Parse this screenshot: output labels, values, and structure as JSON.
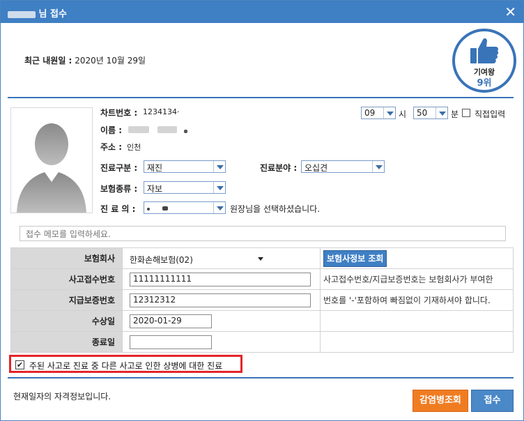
{
  "window": {
    "title_suffix": "님 접수",
    "close_symbol": "✕"
  },
  "header": {
    "recent_label": "최근 내원일 :",
    "recent_date": "2020년 10월 29일"
  },
  "badge": {
    "line1": "기여왕",
    "line2": "9위"
  },
  "patient": {
    "chart_label": "차트번호 :",
    "chart_no": "1234134·",
    "name_label": "이름 :",
    "address_label": "주소 :",
    "address": "인천",
    "visit_type_label": "진료구분 :",
    "visit_type": "재진",
    "field_label": "진료분야 :",
    "field": "오십견",
    "insurance_type_label": "보험종류 :",
    "insurance_type": "자보",
    "doctor_label": "진 료 의 :",
    "doctor_note": "원장님을 선택하셨습니다."
  },
  "time": {
    "hour": "09",
    "hour_unit": "시",
    "minute": "50",
    "minute_unit": "분",
    "manual_label": "직접입력"
  },
  "memo": {
    "placeholder": "접수 메모를 입력하세요."
  },
  "insurance": {
    "company_label": "보험회사",
    "company": "한화손해보험(02)",
    "lookup_button": "보험사정보 조회",
    "accident_no_label": "사고접수번호",
    "accident_no": "11111111111",
    "guarantee_no_label": "지급보증번호",
    "guarantee_no": "12312312",
    "injury_date_label": "수상일",
    "injury_date": "2020-01-29",
    "end_date_label": "종료일",
    "end_date": "",
    "note1": "사고접수번호/지급보증번호는 보험회사가 부여한",
    "note2": "번호를 '-'포함하여 빠짐없이 기재하셔야 합니다."
  },
  "checkbox": {
    "label": "주된 사고로 진료 중 다른 사고로 인한 상병에 대한 진료",
    "checked_mark": "✔"
  },
  "footer": {
    "note": "현재일자의 자격정보입니다.",
    "lookup_button": "감염병조회",
    "submit_button": "접수"
  },
  "colors": {
    "titlebar": "#3f7fc4",
    "accent": "#3a74b8",
    "highlight_border": "#e3262b",
    "orange": "#f07c22"
  }
}
